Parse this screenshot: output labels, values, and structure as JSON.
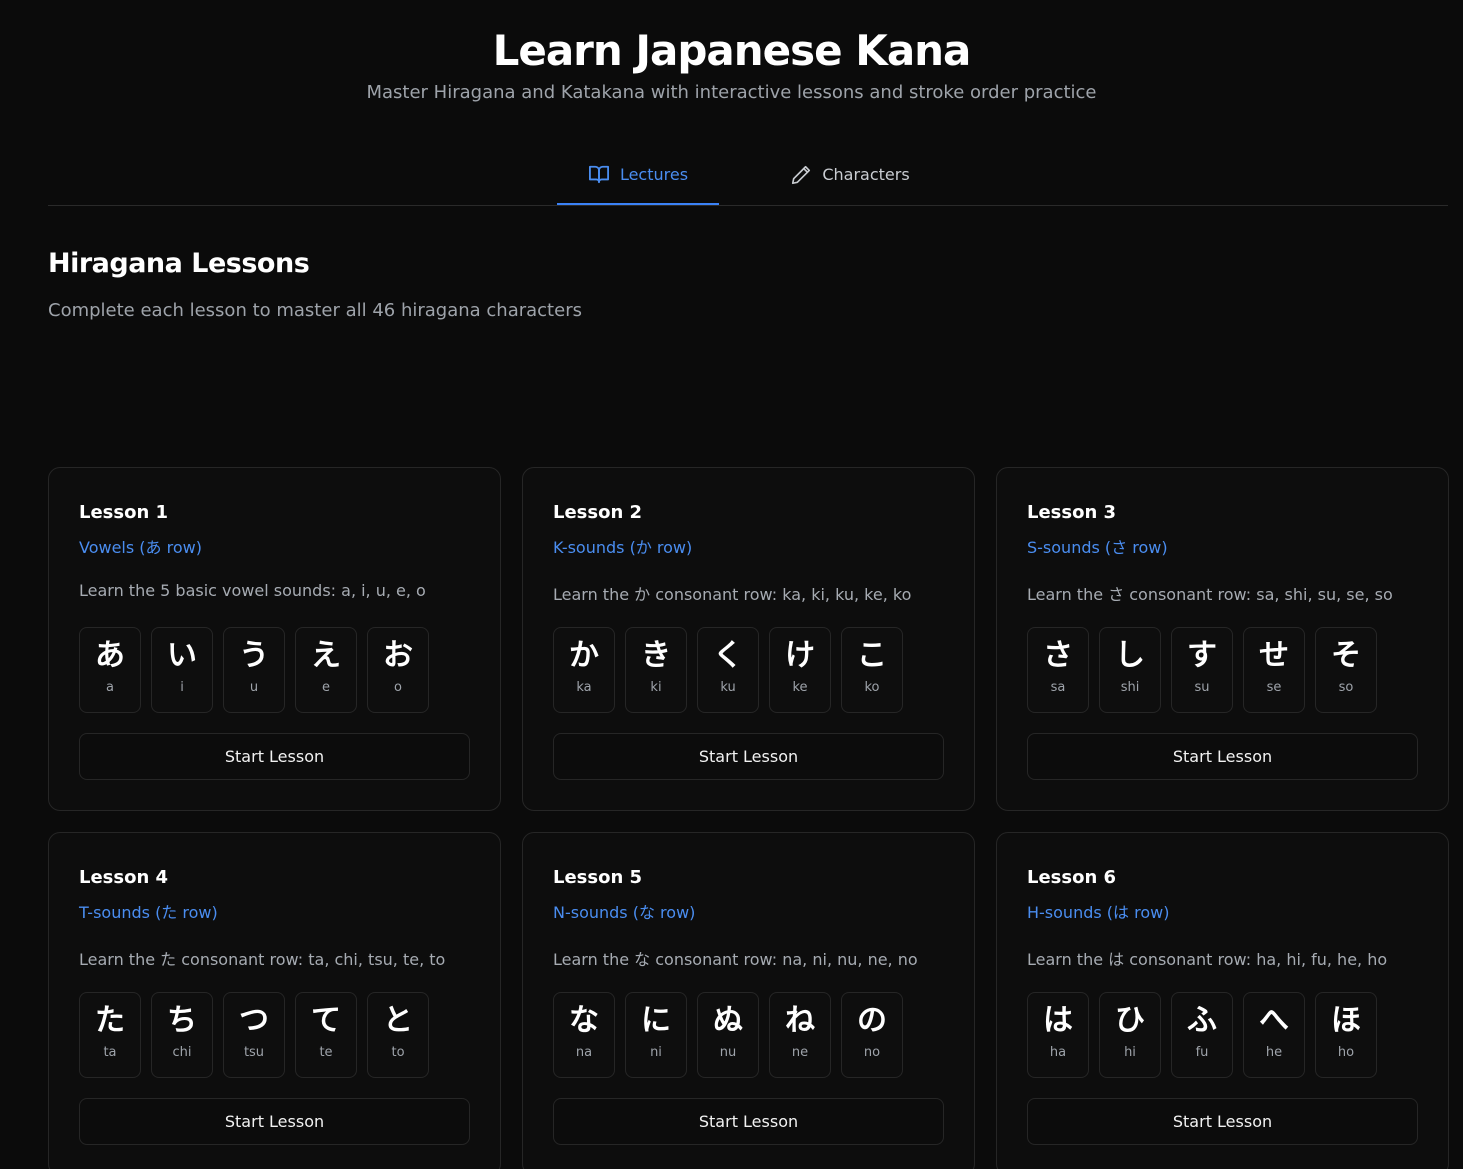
{
  "header": {
    "title": "Learn Japanese Kana",
    "subtitle": "Master Hiragana and Katakana with interactive lessons and stroke order practice"
  },
  "tabs": [
    {
      "label": "Lectures",
      "icon": "book-open-icon",
      "active": true
    },
    {
      "label": "Characters",
      "icon": "pencil-icon",
      "active": false
    }
  ],
  "section": {
    "title": "Hiragana Lessons",
    "subtitle": "Complete each lesson to master all 46 hiragana characters"
  },
  "colors": {
    "accent": "#3b82f6",
    "background": "#0b0b0b",
    "border": "#262626"
  },
  "lessons": [
    {
      "title": "Lesson 1",
      "subtitle": "Vowels (あ row)",
      "description": "Learn the 5 basic vowel sounds: a, i, u, e, o",
      "kana": [
        {
          "char": "あ",
          "romaji": "a"
        },
        {
          "char": "い",
          "romaji": "i"
        },
        {
          "char": "う",
          "romaji": "u"
        },
        {
          "char": "え",
          "romaji": "e"
        },
        {
          "char": "お",
          "romaji": "o"
        }
      ],
      "button": "Start Lesson"
    },
    {
      "title": "Lesson 2",
      "subtitle": "K-sounds (か row)",
      "description": "Learn the か consonant row: ka, ki, ku, ke, ko",
      "kana": [
        {
          "char": "か",
          "romaji": "ka"
        },
        {
          "char": "き",
          "romaji": "ki"
        },
        {
          "char": "く",
          "romaji": "ku"
        },
        {
          "char": "け",
          "romaji": "ke"
        },
        {
          "char": "こ",
          "romaji": "ko"
        }
      ],
      "button": "Start Lesson"
    },
    {
      "title": "Lesson 3",
      "subtitle": "S-sounds (さ row)",
      "description": "Learn the さ consonant row: sa, shi, su, se, so",
      "kana": [
        {
          "char": "さ",
          "romaji": "sa"
        },
        {
          "char": "し",
          "romaji": "shi"
        },
        {
          "char": "す",
          "romaji": "su"
        },
        {
          "char": "せ",
          "romaji": "se"
        },
        {
          "char": "そ",
          "romaji": "so"
        }
      ],
      "button": "Start Lesson"
    },
    {
      "title": "Lesson 4",
      "subtitle": "T-sounds (た row)",
      "description": "Learn the た consonant row: ta, chi, tsu, te, to",
      "kana": [
        {
          "char": "た",
          "romaji": "ta"
        },
        {
          "char": "ち",
          "romaji": "chi"
        },
        {
          "char": "つ",
          "romaji": "tsu"
        },
        {
          "char": "て",
          "romaji": "te"
        },
        {
          "char": "と",
          "romaji": "to"
        }
      ],
      "button": "Start Lesson"
    },
    {
      "title": "Lesson 5",
      "subtitle": "N-sounds (な row)",
      "description": "Learn the な consonant row: na, ni, nu, ne, no",
      "kana": [
        {
          "char": "な",
          "romaji": "na"
        },
        {
          "char": "に",
          "romaji": "ni"
        },
        {
          "char": "ぬ",
          "romaji": "nu"
        },
        {
          "char": "ね",
          "romaji": "ne"
        },
        {
          "char": "の",
          "romaji": "no"
        }
      ],
      "button": "Start Lesson"
    },
    {
      "title": "Lesson 6",
      "subtitle": "H-sounds (は row)",
      "description": "Learn the は consonant row: ha, hi, fu, he, ho",
      "kana": [
        {
          "char": "は",
          "romaji": "ha"
        },
        {
          "char": "ひ",
          "romaji": "hi"
        },
        {
          "char": "ふ",
          "romaji": "fu"
        },
        {
          "char": "へ",
          "romaji": "he"
        },
        {
          "char": "ほ",
          "romaji": "ho"
        }
      ],
      "button": "Start Lesson"
    }
  ]
}
